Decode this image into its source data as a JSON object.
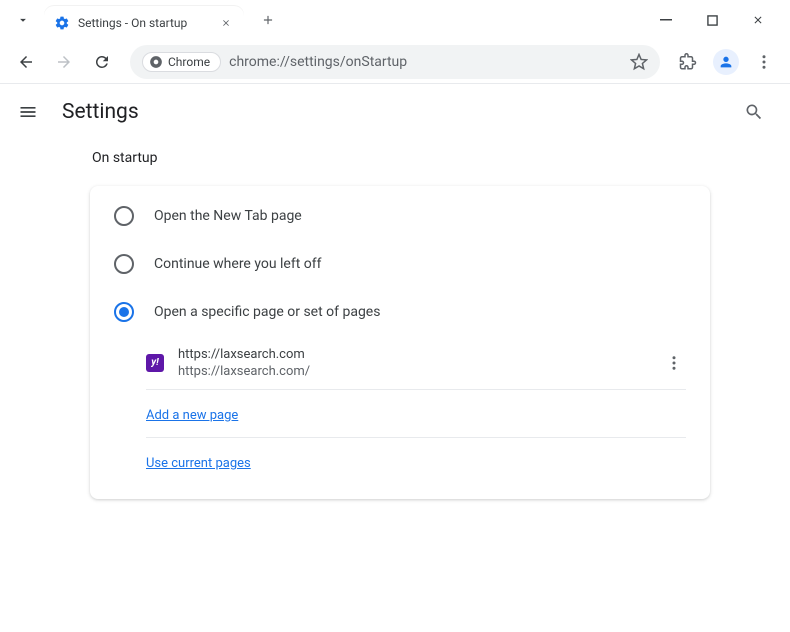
{
  "titlebar": {
    "tab_title": "Settings - On startup"
  },
  "toolbar": {
    "chrome_chip": "Chrome",
    "url": "chrome://settings/onStartup"
  },
  "header": {
    "title": "Settings"
  },
  "section": {
    "label": "On startup",
    "options": [
      {
        "label": "Open the New Tab page"
      },
      {
        "label": "Continue where you left off"
      },
      {
        "label": "Open a specific page or set of pages"
      }
    ],
    "startup_page": {
      "title": "https://laxsearch.com",
      "url": "https://laxsearch.com/"
    },
    "add_page_label": "Add a new page",
    "use_current_label": "Use current pages"
  }
}
